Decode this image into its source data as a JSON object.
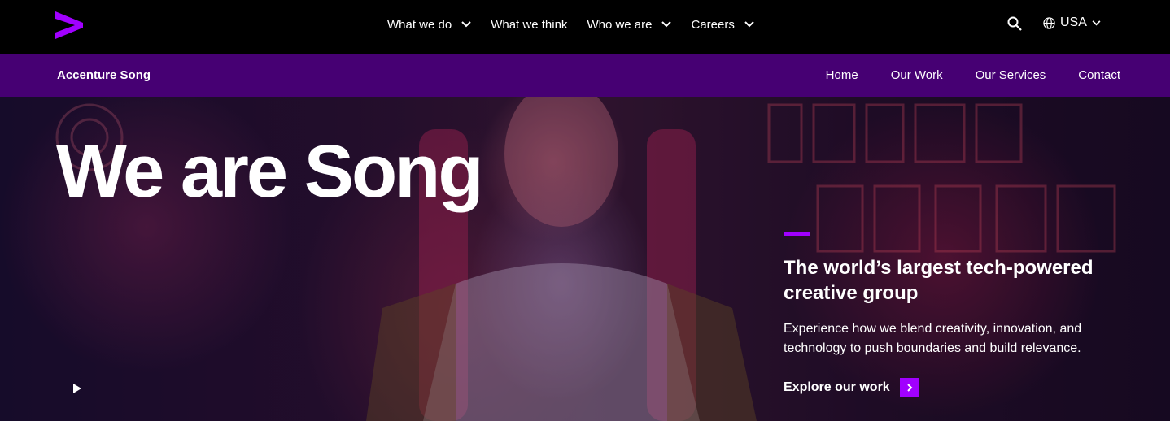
{
  "header": {
    "menu": [
      {
        "label": "What we do",
        "has_dropdown": true
      },
      {
        "label": "What we think",
        "has_dropdown": false
      },
      {
        "label": "Who we are",
        "has_dropdown": true
      },
      {
        "label": "Careers",
        "has_dropdown": true
      }
    ],
    "search_icon": "search-icon",
    "locale": {
      "label": "USA",
      "icon": "globe-icon"
    }
  },
  "subnav": {
    "brand": "Accenture Song",
    "links": [
      "Home",
      "Our Work",
      "Our Services",
      "Contact"
    ]
  },
  "hero": {
    "title": "We are Song",
    "subtitle": "The world’s largest tech-powered creative group",
    "description": "Experience how we blend creativity, innovation, and technology to push boundaries and build relevance.",
    "cta_label": "Explore our work"
  },
  "colors": {
    "brand_purple": "#a100ff",
    "subnav_bg": "#460073",
    "topnav_bg": "#000000"
  }
}
